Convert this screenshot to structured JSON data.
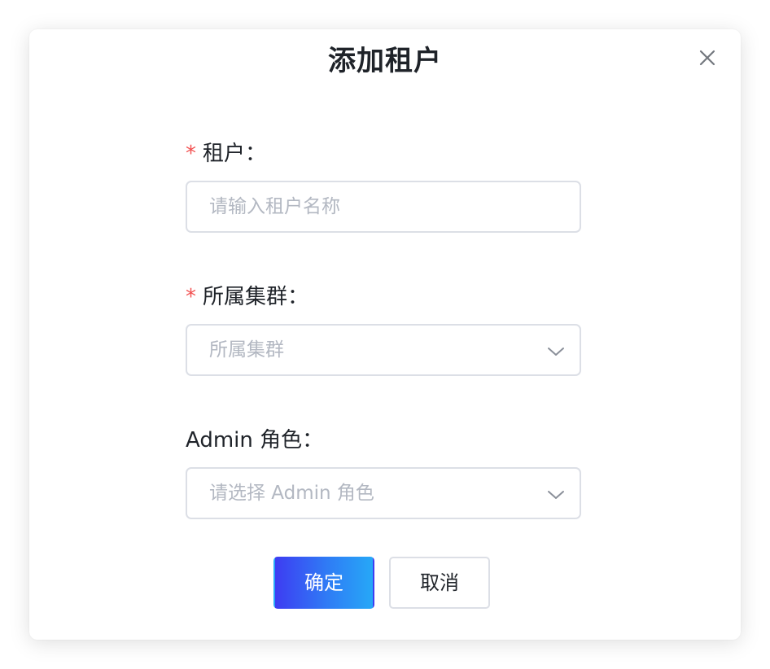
{
  "dialog": {
    "title": "添加租户",
    "close_icon": "close-icon"
  },
  "form": {
    "tenant": {
      "required_mark": "*",
      "label": "租户：",
      "placeholder": "请输入租户名称",
      "value": ""
    },
    "cluster": {
      "required_mark": "*",
      "label": "所属集群：",
      "placeholder": "所属集群",
      "icon": "chevron-down-icon"
    },
    "admin_role": {
      "label": "Admin 角色：",
      "placeholder": "请选择 Admin 角色",
      "icon": "chevron-down-icon"
    }
  },
  "actions": {
    "confirm_label": "确定",
    "cancel_label": "取消"
  },
  "colors": {
    "primary_gradient_start": "#3d3df2",
    "primary_gradient_end": "#26a8f7",
    "required_mark": "#f25252",
    "border": "#dcdfe6",
    "placeholder": "#b3b8c2",
    "text": "#1f2329"
  }
}
